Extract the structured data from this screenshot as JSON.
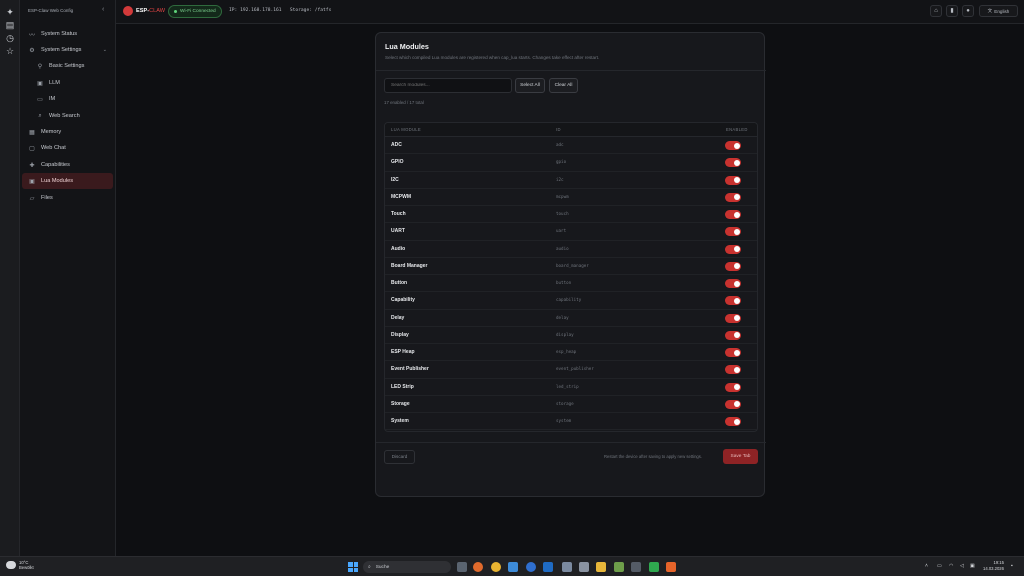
{
  "sidebar": {
    "title": "ESP-Claw Web Config",
    "items": [
      {
        "label": "System Status",
        "icon": "pulse-icon"
      },
      {
        "label": "System Settings",
        "icon": "gear-icon"
      },
      {
        "label": "Basic Settings",
        "icon": "sliders-icon"
      },
      {
        "label": "LLM",
        "icon": "chip-icon"
      },
      {
        "label": "IM",
        "icon": "chat-icon"
      },
      {
        "label": "Web Search",
        "icon": "search-icon"
      },
      {
        "label": "Memory",
        "icon": "memory-icon"
      },
      {
        "label": "Web Chat",
        "icon": "message-icon"
      },
      {
        "label": "Capabilities",
        "icon": "puzzle-icon"
      },
      {
        "label": "Lua Modules",
        "icon": "module-icon"
      },
      {
        "label": "Files",
        "icon": "folder-icon"
      }
    ]
  },
  "topbar": {
    "brand_a": "ESP-",
    "brand_b": "CLAW",
    "wifi_status": "Wi-Fi Connected",
    "ip_storage": "IP: 192.168.178.161   Storage: /fatfs",
    "language": "English"
  },
  "modal": {
    "title": "Lua Modules",
    "subtitle": "Select which compiled Lua modules are registered when cap_lua starts. Changes take effect after restart.",
    "search_placeholder": "Search modules...",
    "select_all": "Select All",
    "clear_all": "Clear All",
    "count": "17 enabled / 17 total",
    "columns": {
      "module": "LUA MODULE",
      "id": "ID",
      "enabled": "ENABLED"
    },
    "rows": [
      {
        "name": "ADC",
        "id": "adc",
        "enabled": true
      },
      {
        "name": "GPIO",
        "id": "gpio",
        "enabled": true
      },
      {
        "name": "I2C",
        "id": "i2c",
        "enabled": true
      },
      {
        "name": "MCPWM",
        "id": "mcpwm",
        "enabled": true
      },
      {
        "name": "Touch",
        "id": "touch",
        "enabled": true
      },
      {
        "name": "UART",
        "id": "uart",
        "enabled": true
      },
      {
        "name": "Audio",
        "id": "audio",
        "enabled": true
      },
      {
        "name": "Board Manager",
        "id": "board_manager",
        "enabled": true
      },
      {
        "name": "Button",
        "id": "button",
        "enabled": true
      },
      {
        "name": "Capability",
        "id": "capability",
        "enabled": true
      },
      {
        "name": "Delay",
        "id": "delay",
        "enabled": true
      },
      {
        "name": "Display",
        "id": "display",
        "enabled": true
      },
      {
        "name": "ESP Heap",
        "id": "esp_heap",
        "enabled": true
      },
      {
        "name": "Event Publisher",
        "id": "event_publisher",
        "enabled": true
      },
      {
        "name": "LED Strip",
        "id": "led_strip",
        "enabled": true
      },
      {
        "name": "Storage",
        "id": "storage",
        "enabled": true
      },
      {
        "name": "System",
        "id": "system",
        "enabled": true
      }
    ],
    "discard": "Discard",
    "restart_hint": "Restart the device after saving to apply new settings.",
    "save": "Save Tab"
  },
  "taskbar": {
    "temp": "10°C",
    "weather": "Bewölkt",
    "search": "Suche",
    "time": "19:15",
    "date": "14.03.2026"
  },
  "colors": {
    "accent": "#c8322f",
    "wifi": "#5fd37a",
    "background": "#0e0f12"
  }
}
